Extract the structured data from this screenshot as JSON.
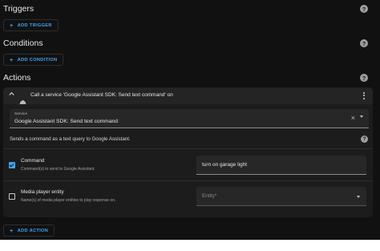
{
  "sections": {
    "triggers": "Triggers",
    "conditions": "Conditions",
    "actions": "Actions"
  },
  "buttons": {
    "add_trigger": "ADD TRIGGER",
    "add_condition": "ADD CONDITION",
    "add_action": "ADD ACTION",
    "plus": "+"
  },
  "help_glyph": "?",
  "action_card": {
    "header": "Call a service 'Google Assistant SDK: Send text command' on",
    "service_field": {
      "label": "Service",
      "value": "Google Assistant SDK: Send text command"
    },
    "clear_glyph": "×",
    "description": "Sends a command as a text query to Google Assistant.",
    "fields": [
      {
        "name": "Command",
        "description": "Command(s) to send to Google Assistant.",
        "checked": true,
        "value": "turn on garage light"
      },
      {
        "name": "Media player entity",
        "description": "Name(s) of media player entities to play response on.",
        "checked": false,
        "placeholder": "Entity*"
      }
    ]
  },
  "icons": {
    "help": "help-circle-icon",
    "chevron": "chevron-up-icon",
    "service": "room-service-icon",
    "menu": "dots-vertical-icon",
    "clear": "close-icon",
    "dropdown": "menu-down-icon"
  },
  "colors": {
    "background": "#111111",
    "card": "#1c1c1c",
    "accent": "#42a5f5"
  }
}
